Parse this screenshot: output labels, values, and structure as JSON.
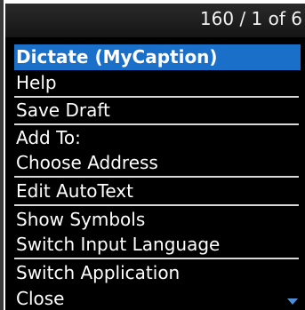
{
  "status": {
    "counter": "160 / 1 of 6"
  },
  "menu": {
    "items": [
      {
        "label": "Dictate (MyCaption)"
      },
      {
        "label": "Help"
      },
      {
        "label": "Save Draft"
      },
      {
        "label": "Add To:"
      },
      {
        "label": "Choose Address"
      },
      {
        "label": "Edit AutoText"
      },
      {
        "label": "Show Symbols"
      },
      {
        "label": "Switch Input Language"
      },
      {
        "label": "Switch Application"
      },
      {
        "label": "Close"
      }
    ]
  },
  "colors": {
    "highlight": "#1a6fc9",
    "menu_background": "#000000",
    "separator": "#d8d8d8",
    "scroll_arrow": "#4f8fd8"
  },
  "icons": {
    "scroll": "scroll-down-arrow-icon"
  }
}
